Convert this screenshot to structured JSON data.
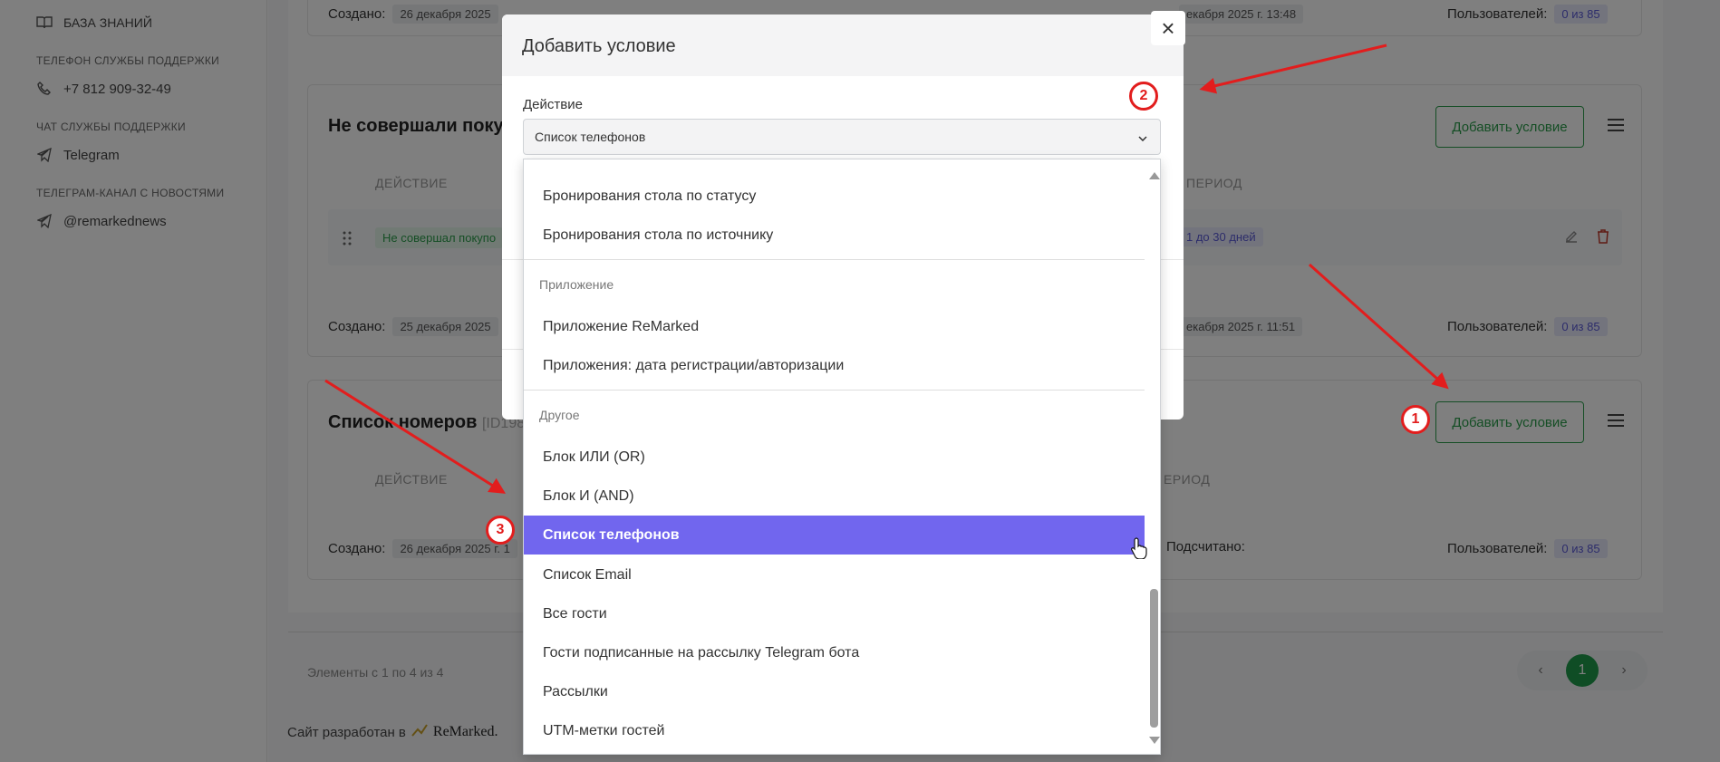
{
  "sidebar": {
    "knowledge_base": "БАЗА ЗНАНИЙ",
    "support_phone_caption": "ТЕЛЕФОН СЛУЖБЫ ПОДДЕРЖКИ",
    "support_phone": "+7 812 909-32-49",
    "support_chat_caption": "ЧАТ СЛУЖБЫ ПОДДЕРЖКИ",
    "support_chat": "Telegram",
    "news_channel_caption": "ТЕЛЕГРАМ-КАНАЛ С НОВОСТЯМИ",
    "news_channel": "@remarkednews"
  },
  "cards": [
    {
      "created_label": "Создано:",
      "created_chip": "26 декабря 2025",
      "date_chip": "екабря 2025 г. 13:48",
      "users_label": "Пользователей:",
      "users_chip": "0 из 85"
    },
    {
      "title": "Не совершали поку",
      "add_condition": "Добавить условие",
      "col_action": "ДЕЙСТВИЕ",
      "col_period": "ПЕРИОД",
      "row_chip": "Не совершал покупо",
      "period_chip": "1 до 30 дней",
      "created_label": "Создано:",
      "created_chip": "25 декабря 2025",
      "date_chip": "екабря 2025 г. 11:51",
      "users_label": "Пользователей:",
      "users_chip": "0 из 85"
    },
    {
      "title": "Список номеров",
      "id_text": "[ID198",
      "add_condition": "Добавить условие",
      "col_action": "ДЕЙСТВИЕ",
      "col_period": "ЕРИОД",
      "created_label": "Создано:",
      "created_chip": "26 декабря 2025 г. 1",
      "counted_label": "Подсчитано:",
      "users_label": "Пользователей:",
      "users_chip": "0 из 85"
    }
  ],
  "footer": {
    "elements_text": "Элементы с 1 по 4 из 4",
    "page_prev": "‹",
    "page_current": "1",
    "page_next": "›",
    "developed_by": "Сайт разработан в",
    "brand": "ReMarked."
  },
  "modal": {
    "title": "Добавить условие",
    "close": "×",
    "field_label": "Действие",
    "select_value": "Список телефонов",
    "dropdown": {
      "items_top": [
        "Бронирования стола по статусу",
        "Бронирования стола по источнику"
      ],
      "group_app": "Приложение",
      "items_app": [
        "Приложение ReMarked",
        "Приложения: дата регистрации/авторизации"
      ],
      "group_other": "Другое",
      "items_other": [
        "Блок ИЛИ (OR)",
        "Блок И (AND)",
        "Список телефонов",
        "Список Email",
        "Все гости",
        "Гости подписанные на рассылку Telegram бота",
        "Рассылки",
        "UTM-метки гостей"
      ]
    }
  },
  "annotations": {
    "badge_1": "1",
    "badge_2": "2",
    "badge_3": "3",
    "arrow_color": "#e21d1d"
  },
  "colors": {
    "accent_green": "#2a9d4a",
    "selected_item": "#7166ee",
    "chip_blue_text": "#5a5ad6"
  }
}
